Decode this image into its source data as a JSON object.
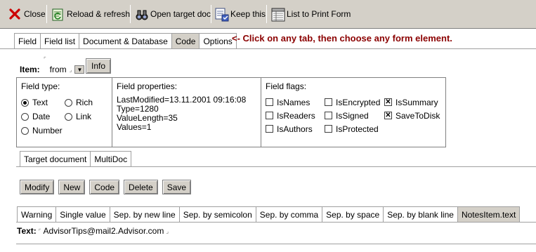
{
  "toolbar": {
    "close": "Close",
    "reload": "Reload & refresh",
    "open_target": "Open target doc",
    "keep": "Keep this",
    "list_print": "List to Print Form"
  },
  "main_tabs": [
    "Field",
    "Field list",
    "Document & Database",
    "Code",
    "Options"
  ],
  "main_tab_active": "Code",
  "hint": "<- Click on any tab, then choose any form element.",
  "item": {
    "label": "Item:",
    "value": "from",
    "info_button": "Info"
  },
  "field_type": {
    "title": "Field type:",
    "options": [
      {
        "label": "Text",
        "selected": true
      },
      {
        "label": "Rich",
        "selected": false
      },
      {
        "label": "Date",
        "selected": false
      },
      {
        "label": "Link",
        "selected": false
      },
      {
        "label": "Number",
        "selected": false
      }
    ]
  },
  "field_properties": {
    "title": "Field properties:",
    "lines": [
      "LastModified=13.11.2001 09:16:08",
      "Type=1280",
      "ValueLength=35",
      "Values=1"
    ]
  },
  "field_flags": {
    "title": "Field flags:",
    "flags": [
      {
        "label": "IsNames",
        "checked": false
      },
      {
        "label": "IsEncrypted",
        "checked": false
      },
      {
        "label": "IsSummary",
        "checked": true
      },
      {
        "label": "IsReaders",
        "checked": false
      },
      {
        "label": "IsSigned",
        "checked": false
      },
      {
        "label": "SaveToDisk",
        "checked": true
      },
      {
        "label": "IsAuthors",
        "checked": false
      },
      {
        "label": "IsProtected",
        "checked": false
      }
    ]
  },
  "doc_tabs": [
    "Target document",
    "MultiDoc"
  ],
  "actions": [
    "Modify",
    "New",
    "Code",
    "Delete",
    "Save"
  ],
  "value_tabs": [
    "Warning",
    "Single value",
    "Sep. by new line",
    "Sep. by semicolon",
    "Sep. by comma",
    "Sep. by space",
    "Sep. by blank line",
    "NotesItem.text"
  ],
  "value_tab_active": "NotesItem.text",
  "text_value": {
    "label": "Text:",
    "value": "AdvisorTips@mail2.Advisor.com"
  },
  "colors": {
    "toolbar": "#d4d0c8",
    "hint": "#8b0000",
    "close_x": "#cc0000"
  }
}
